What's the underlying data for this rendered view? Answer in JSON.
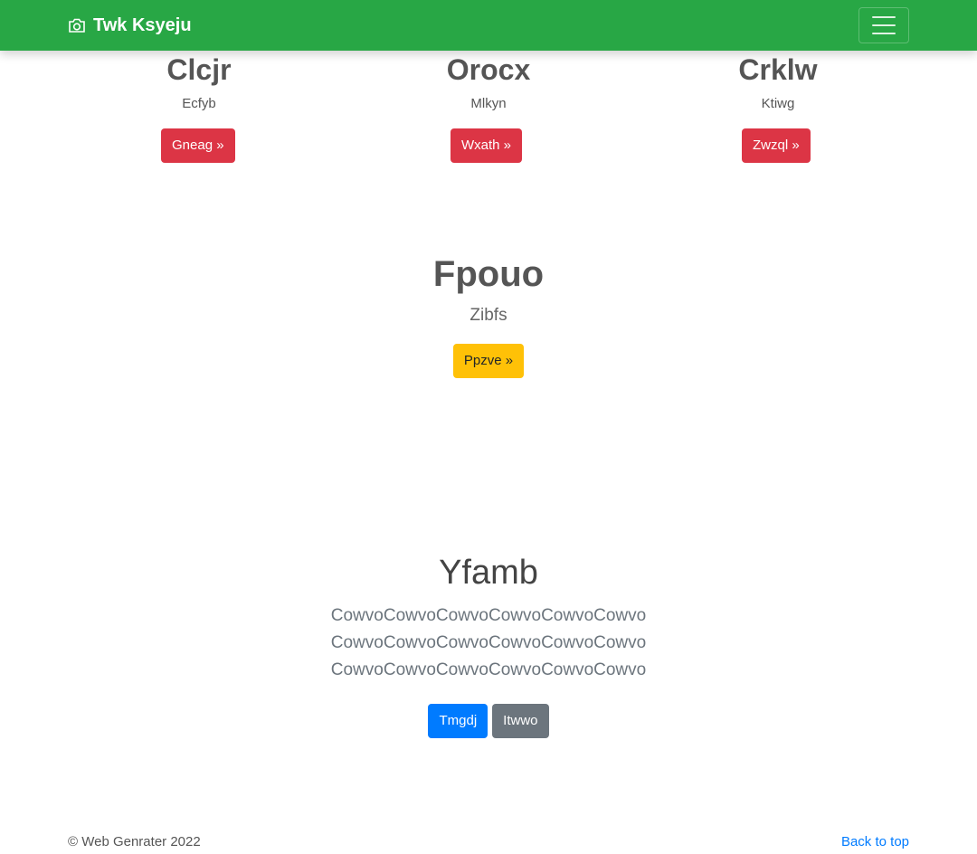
{
  "navbar": {
    "brand_icon": "camera-icon",
    "brand": "Twk Ksyeju",
    "toggler_icon": "hamburger-menu-icon"
  },
  "columns": [
    {
      "heading": "Clcjr",
      "text": "Ecfyb",
      "button": "Gneag »"
    },
    {
      "heading": "Orocx",
      "text": "Mlkyn",
      "button": "Wxath »"
    },
    {
      "heading": "Crklw",
      "text": "Ktiwg",
      "button": "Zwzql »"
    }
  ],
  "featured": {
    "heading": "Fpouo",
    "text": "Zibfs",
    "button": "Ppzve »"
  },
  "jumbotron": {
    "heading": "Yfamb",
    "lead": "CowvoCowvoCowvoCowvoCowvoCowvoCowvoCowvoCowvoCowvoCowvoCowvoCowvoCowvoCowvoCowvoCowvoCowvo",
    "primary_button": "Tmgdj",
    "secondary_button": "Itwwo"
  },
  "footer": {
    "copyright": "© Web Genrater 2022",
    "back_to_top": "Back to top"
  },
  "colors": {
    "navbar": "#28a745",
    "danger": "#dc3545",
    "warning": "#ffc107",
    "primary": "#007bff",
    "secondary": "#6c757d"
  }
}
